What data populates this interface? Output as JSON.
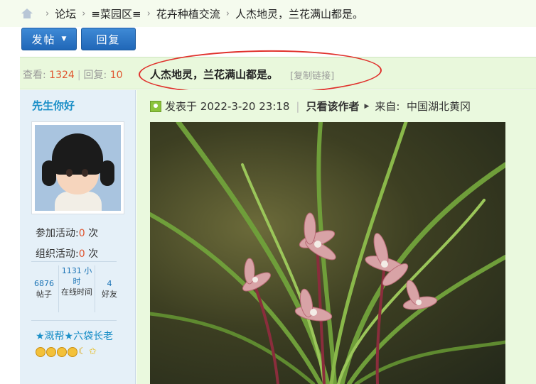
{
  "breadcrumb": {
    "items": [
      "论坛",
      "≡菜园区≡",
      "花卉种植交流",
      "人杰地灵，兰花满山都是。"
    ]
  },
  "actions": {
    "post_label": "发帖",
    "reply_label": "回复"
  },
  "thread": {
    "views_label": "查看:",
    "views": "1324",
    "replies_label": "回复:",
    "replies": "10",
    "title": "人杰地灵，兰花满山都是。",
    "copy_link": "[复制链接]"
  },
  "author": {
    "name": "先生你好",
    "activity_join_label": "参加活动:",
    "activity_join": "0",
    "activity_org_label": "组织活动:",
    "activity_org": "0",
    "times_unit": "次",
    "posts_value": "6876",
    "posts_label": "帖子",
    "online_value": "1131 小时",
    "online_label": "在线时间",
    "friends_value": "4",
    "friends_label": "好友",
    "group": "★溉帮★六袋长老"
  },
  "post": {
    "posted_label": "发表于",
    "datetime": "2022-3-20 23:18",
    "only_author": "只看该作者",
    "from_label": "来自:",
    "from_value": "中国湖北黄冈"
  },
  "colors": {
    "accent_blue": "#2067b8",
    "highlight_red": "#e0312c",
    "number_orange": "#e0552f",
    "author_blue": "#1a8fc7"
  }
}
